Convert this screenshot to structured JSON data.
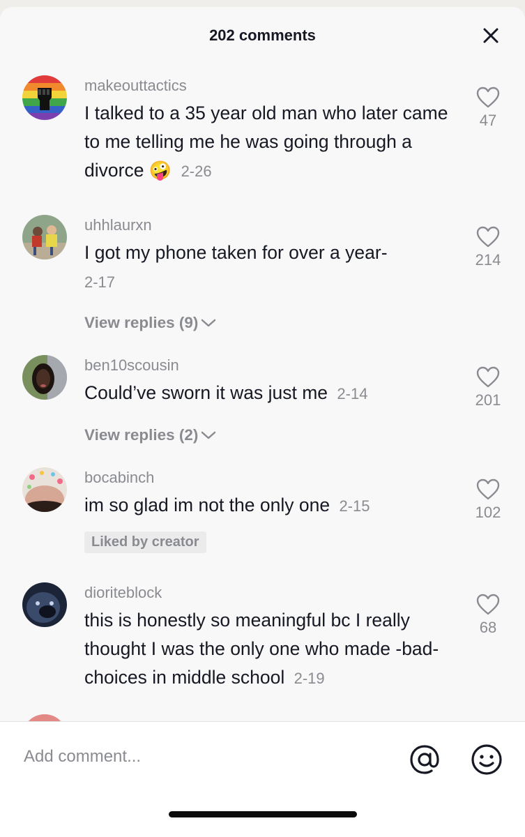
{
  "header": {
    "title": "202 comments"
  },
  "comments": [
    {
      "username": "makeouttactics",
      "text_main": "I talked to a 35 year old man who later came to me telling me he was going through a divorce",
      "emoji": "🤪",
      "date": "2-26",
      "likes": "47"
    },
    {
      "username": "uhhlaurxn",
      "text_main": "I got my phone taken for over a year-",
      "date": "2-17",
      "likes": "214",
      "replies_label": "View replies (9)"
    },
    {
      "username": "ben10scousin",
      "text_main": "Could’ve sworn it was just me",
      "date": "2-14",
      "likes": "201",
      "replies_label": "View replies (2)"
    },
    {
      "username": "bocabinch",
      "text_main": "im so glad im not the only one",
      "date": "2-15",
      "likes": "102",
      "badge": "Liked by creator"
    },
    {
      "username": "dioriteblock",
      "text_main": "this is honestly so meaningful bc I really thought I was the only one who made -bad- choices in middle school",
      "date": "2-19",
      "likes": "68"
    }
  ],
  "input": {
    "placeholder": "Add comment..."
  },
  "icons": {
    "close": "close-icon",
    "like": "heart-outline-icon",
    "chevron": "chevron-down-icon",
    "mention": "at-sign-icon",
    "emoji": "emoji-smile-icon"
  },
  "colors": {
    "text_primary": "#161823",
    "text_secondary": "#8a8b91",
    "sheet_background": "#f8f8f8",
    "badge_background": "#ebebeb"
  }
}
